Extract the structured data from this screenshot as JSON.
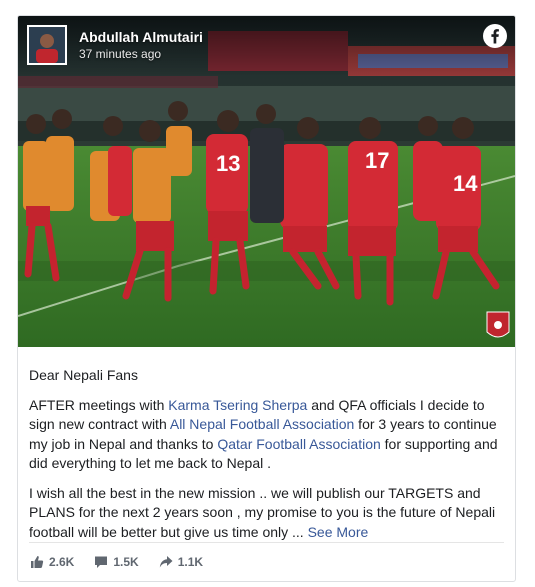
{
  "post": {
    "author": "Abdullah Almutairi",
    "timestamp": "37 minutes ago",
    "greeting": "Dear Nepali Fans",
    "paragraph1": {
      "t1": "AFTER meetings with ",
      "link1": "Karma Tsering Sherpa",
      "t2": " and QFA officials I decide to sign new contract with ",
      "link2": "All Nepal Football Association",
      "t3": " for 3 years to continue my job in Nepal and thanks to ",
      "link3": "Qatar Football Association",
      "t4": " for supporting and did everything to let me back to Nepal ."
    },
    "paragraph2": {
      "text": "I wish all the best in the new mission .. we will publish our TARGETS and PLANS for the next 2 years soon , my promise to you is the future of Nepali football will be better but give us time only ... ",
      "see_more": "See More"
    },
    "photo": {
      "jersey_numbers": [
        "13",
        "17",
        "14"
      ]
    }
  },
  "stats": {
    "likes": "2.6K",
    "comments": "1.5K",
    "shares": "1.1K"
  },
  "icons": {
    "platform": "facebook-icon",
    "like": "thumbs-up-icon",
    "comment": "comment-icon",
    "share": "share-arrow-icon",
    "badge": "anfa-crest-icon"
  },
  "colors": {
    "link": "#385898",
    "text": "#1c1e21",
    "muted": "#606770",
    "jersey_red": "#d32a35",
    "bib_orange": "#e08a2e",
    "pitch_green": "#3e7a2a"
  }
}
